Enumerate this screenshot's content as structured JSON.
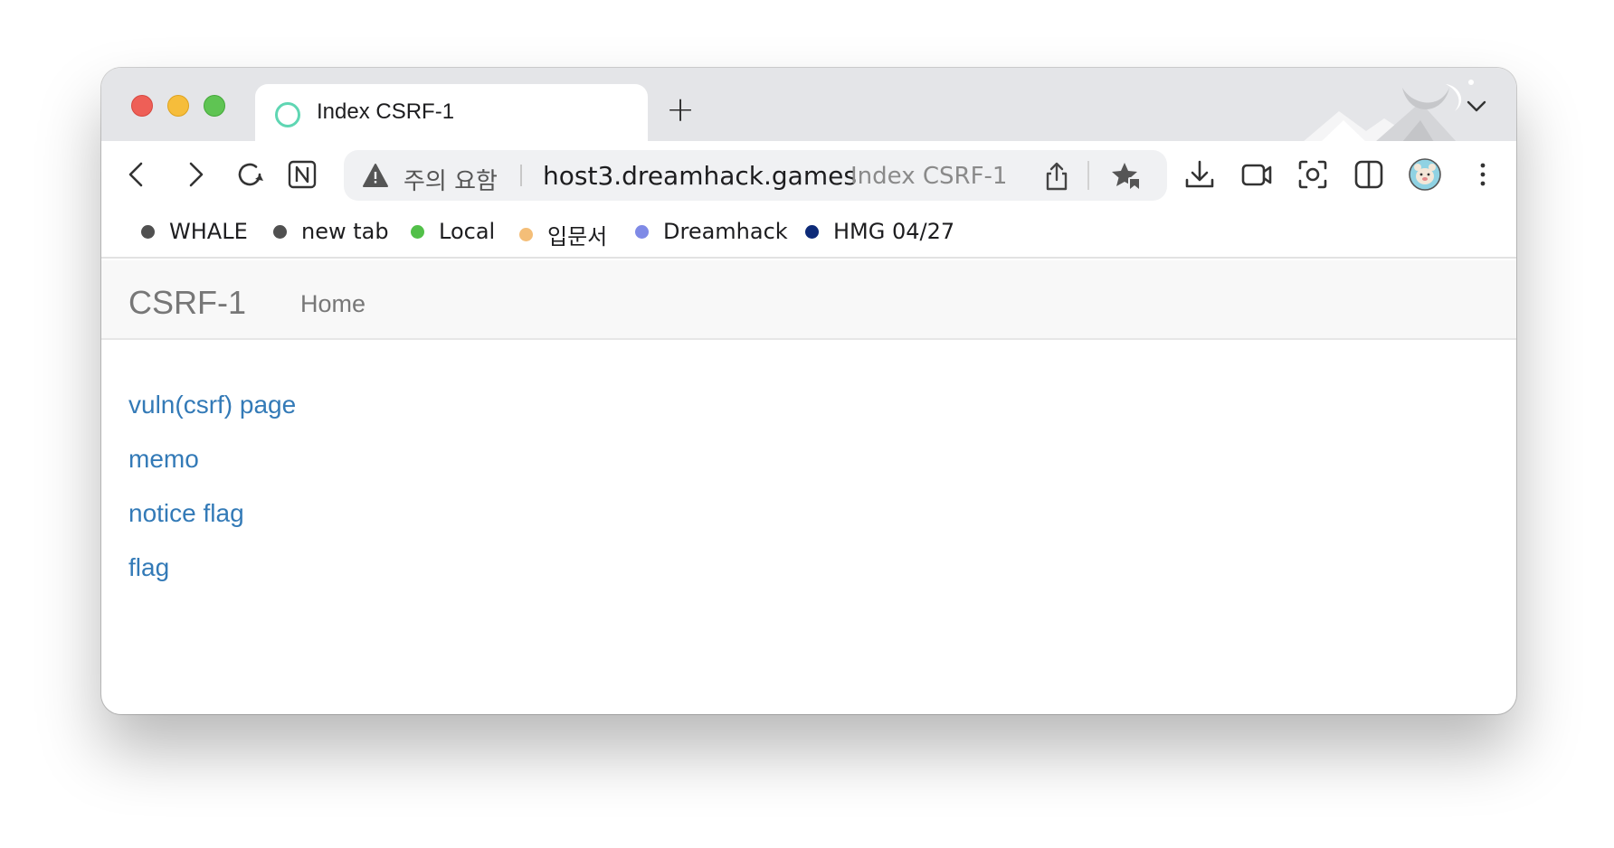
{
  "window": {
    "tab": {
      "title": "Index CSRF-1",
      "favicon": "ring-icon"
    },
    "new_tab_label": "+"
  },
  "toolbar": {
    "icons": [
      "back-icon",
      "forward-icon",
      "reload-icon",
      "n-app-icon",
      "download-icon",
      "video-icon",
      "screenshot-icon",
      "sidebar-icon",
      "profile-avatar",
      "more-icon"
    ],
    "omnibox": {
      "warning_icon": "warning-icon",
      "warning_text": "주의 요함",
      "host": "host3.dreamhack.games",
      "page_title": "Index CSRF-1"
    }
  },
  "bookmarks": [
    {
      "label": "WHALE",
      "color": "#505050"
    },
    {
      "label": "new tab",
      "color": "#505050"
    },
    {
      "label": "Local",
      "color": "#52c049"
    },
    {
      "label": "입문서",
      "color": "#f4be78"
    },
    {
      "label": "Dreamhack",
      "color": "#7f8ae6"
    },
    {
      "label": "HMG 04/27",
      "color": "#0d2a78"
    }
  ],
  "page": {
    "navbar": {
      "brand": "CSRF-1",
      "home": "Home"
    },
    "links": [
      "vuln(csrf) page",
      "memo",
      "notice flag",
      "flag"
    ],
    "link_color": "#337ab7"
  }
}
